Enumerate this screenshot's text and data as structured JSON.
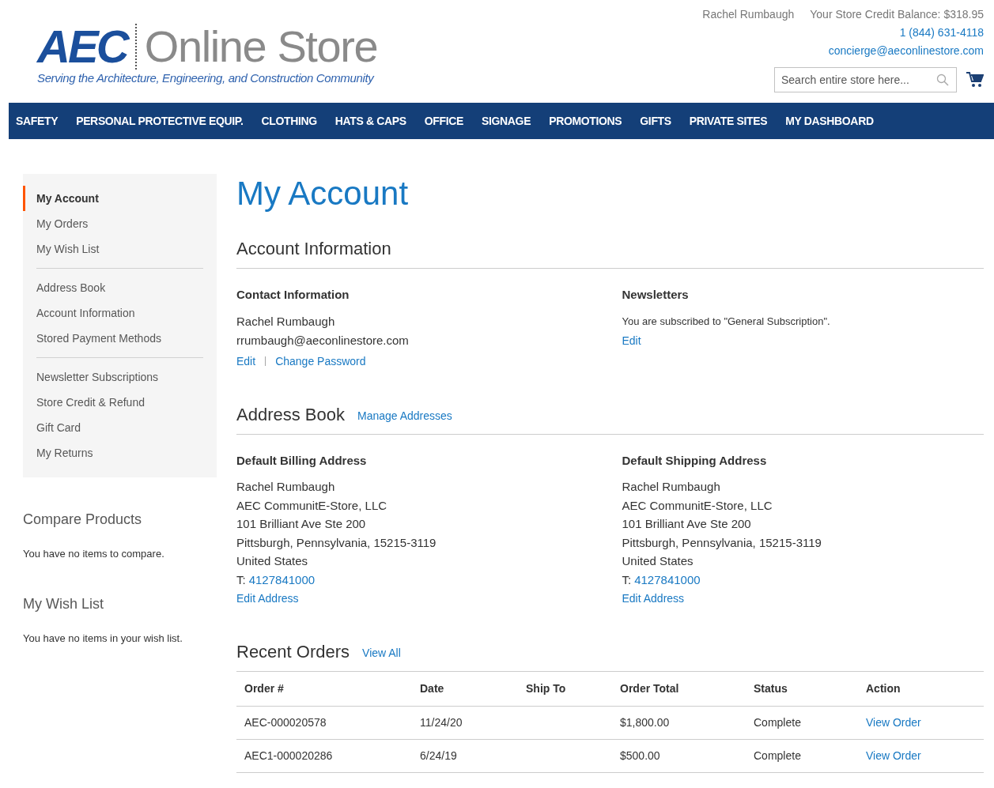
{
  "header": {
    "logo": {
      "mark": "AEC",
      "name": "Online Store",
      "tagline": "Serving the Architecture, Engineering, and Construction Community"
    },
    "customer_name": "Rachel Rumbaugh",
    "credit_balance": "Your Store Credit Balance: $318.95",
    "phone": "1 (844) 631-4118",
    "email": "concierge@aeconlinestore.com",
    "search": {
      "placeholder": "Search entire store here..."
    }
  },
  "nav": [
    "SAFETY",
    "PERSONAL PROTECTIVE EQUIP.",
    "CLOTHING",
    "HATS & CAPS",
    "OFFICE",
    "SIGNAGE",
    "PROMOTIONS",
    "GIFTS",
    "PRIVATE SITES",
    "MY DASHBOARD"
  ],
  "sidebar": {
    "groups": [
      {
        "items": [
          {
            "label": "My Account",
            "selected": true
          },
          {
            "label": "My Orders",
            "selected": false
          },
          {
            "label": "My Wish List",
            "selected": false
          }
        ]
      },
      {
        "items": [
          {
            "label": "Address Book",
            "selected": false
          },
          {
            "label": "Account Information",
            "selected": false
          },
          {
            "label": "Stored Payment Methods",
            "selected": false
          }
        ]
      },
      {
        "items": [
          {
            "label": "Newsletter Subscriptions",
            "selected": false
          },
          {
            "label": "Store Credit & Refund",
            "selected": false
          },
          {
            "label": "Gift Card",
            "selected": false
          },
          {
            "label": "My Returns",
            "selected": false
          }
        ]
      }
    ],
    "blocks": [
      {
        "title": "Compare Products",
        "text": "You have no items to compare."
      },
      {
        "title": "My Wish List",
        "text": "You have no items in your wish list."
      }
    ]
  },
  "page_title": "My Account",
  "account_information": {
    "title": "Account Information",
    "contact": {
      "title": "Contact Information",
      "lines": [
        "Rachel Rumbaugh",
        "rrumbaugh@aeconlinestore.com"
      ],
      "links": [
        "Edit",
        "Change Password"
      ]
    },
    "newsletters": {
      "title": "Newsletters",
      "text": "You are subscribed to \"General Subscription\".",
      "link": "Edit"
    }
  },
  "address_book": {
    "title": "Address Book",
    "link": "Manage Addresses",
    "addresses": [
      {
        "title": "Default Billing Address",
        "lines": [
          "Rachel Rumbaugh",
          "AEC CommunitE-Store, LLC",
          "101 Brilliant Ave Ste 200",
          "Pittsburgh, Pennsylvania, 15215-3119",
          "United States"
        ],
        "phone_label": "T:",
        "phone": "4127841000",
        "link": "Edit Address"
      },
      {
        "title": "Default Shipping Address",
        "lines": [
          "Rachel Rumbaugh",
          "AEC CommunitE-Store, LLC",
          "101 Brilliant Ave Ste 200",
          "Pittsburgh, Pennsylvania, 15215-3119",
          "United States"
        ],
        "phone_label": "T:",
        "phone": "4127841000",
        "link": "Edit Address"
      }
    ]
  },
  "recent_orders": {
    "title": "Recent Orders",
    "link": "View All",
    "columns": [
      "Order #",
      "Date",
      "Ship To",
      "Order Total",
      "Status",
      "Action"
    ],
    "rows": [
      {
        "order": "AEC-000020578",
        "date": "11/24/20",
        "total": "$1,800.00",
        "status": "Complete",
        "action": "View Order"
      },
      {
        "order": "AEC1-000020286",
        "date": "6/24/19",
        "total": "$500.00",
        "status": "Complete",
        "action": "View Order"
      }
    ]
  }
}
